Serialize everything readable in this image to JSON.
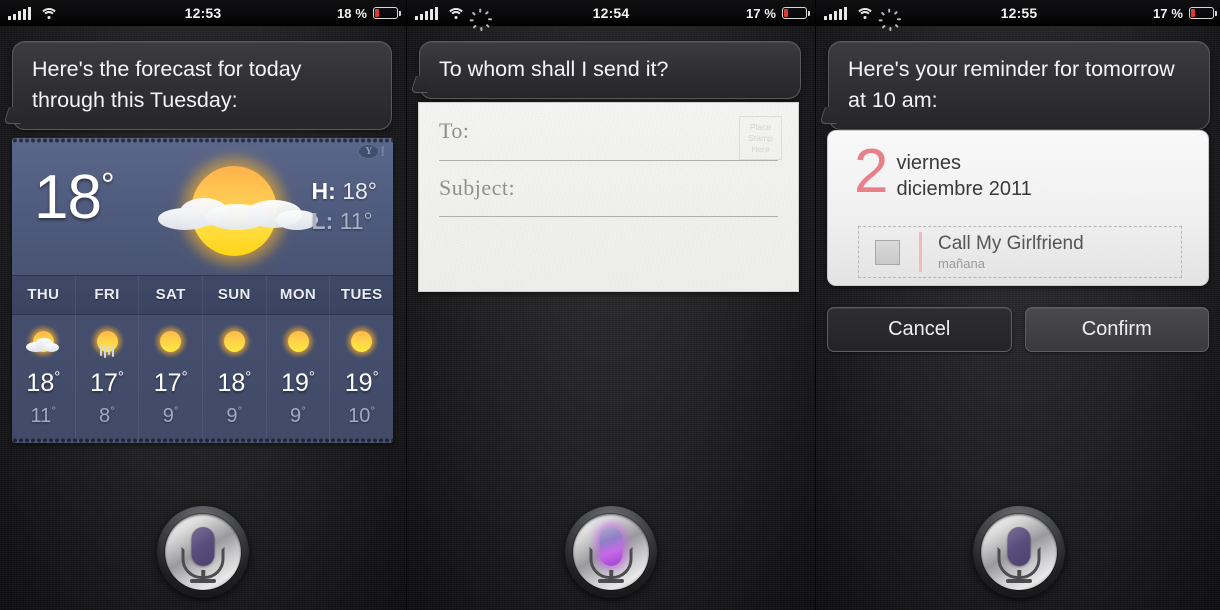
{
  "colors": {
    "accent_purple": "#7a6e96",
    "accent_purple_active": "#c869e8",
    "battery_red": "#e03636",
    "reminder_red": "#e8808a",
    "weather_bg": "#4a5575",
    "card_white": "#f4f4f2"
  },
  "panels": [
    {
      "id": "weather-panel",
      "status": {
        "time": "12:53",
        "battery_percent": "18 %",
        "battery_level": 18,
        "signal_bars": 5,
        "wifi": "wifi-icon",
        "activity": null
      },
      "bubble": "Here's the forecast for today through this Tuesday:",
      "mic": {
        "name": "siri-mic-button",
        "active": false
      },
      "weather": {
        "provider": "Yahoo!",
        "current_temp": "18",
        "degree": "°",
        "high_label": "H:",
        "high_value": "18°",
        "low_label": "L:",
        "low_value": "11°",
        "condition_icon": "sun-behind-cloud-icon",
        "days": [
          "THU",
          "FRI",
          "SAT",
          "SUN",
          "MON",
          "TUES"
        ],
        "forecast": [
          {
            "day": "THU",
            "icon": "sun-behind-cloud-icon",
            "high": "18",
            "low": "11"
          },
          {
            "day": "FRI",
            "icon": "sun-behind-rain-icon",
            "high": "17",
            "low": "8"
          },
          {
            "day": "SAT",
            "icon": "sun-icon",
            "high": "17",
            "low": "9"
          },
          {
            "day": "SUN",
            "icon": "sun-icon",
            "high": "18",
            "low": "9"
          },
          {
            "day": "MON",
            "icon": "sun-icon",
            "high": "19",
            "low": "9"
          },
          {
            "day": "TUES",
            "icon": "sun-icon",
            "high": "19",
            "low": "10"
          }
        ]
      }
    },
    {
      "id": "email-panel",
      "status": {
        "time": "12:54",
        "battery_percent": "17 %",
        "battery_level": 17,
        "signal_bars": 5,
        "wifi": "wifi-icon",
        "activity": "activity-spinner-icon"
      },
      "bubble": "To whom shall I send it?",
      "mic": {
        "name": "siri-mic-button",
        "active": true
      },
      "email": {
        "to_label": "To:",
        "to_value": "",
        "subject_label": "Subject:",
        "subject_value": "",
        "body_value": "",
        "stamp_lines": [
          "Place",
          "Stamp",
          "Here"
        ]
      }
    },
    {
      "id": "reminder-panel",
      "status": {
        "time": "12:55",
        "battery_percent": "17 %",
        "battery_level": 17,
        "signal_bars": 5,
        "wifi": "wifi-icon",
        "activity": "activity-spinner-icon"
      },
      "bubble": "Here's your reminder for tomorrow at 10 am:",
      "mic": {
        "name": "siri-mic-button",
        "active": false
      },
      "reminder": {
        "day_number": "2",
        "day_of_week": "viernes",
        "month_year": "diciembre 2011",
        "item_title": "Call My Girlfriend",
        "item_subtitle": "mañana",
        "checked": false
      },
      "buttons": {
        "cancel": "Cancel",
        "confirm": "Confirm"
      }
    }
  ]
}
